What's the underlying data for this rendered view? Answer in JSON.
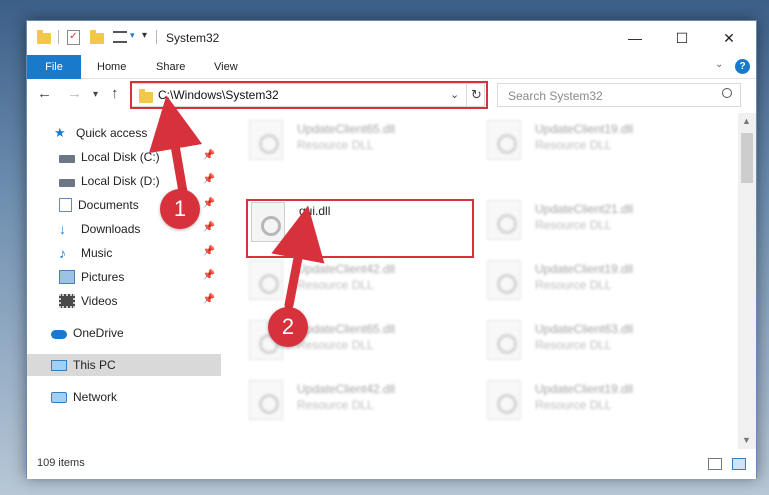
{
  "window": {
    "title": "System32",
    "controls": {
      "minimize": "—",
      "maximize": "☐",
      "close": "✕"
    }
  },
  "ribbon": {
    "file_tab": "File",
    "tabs": [
      "Home",
      "Share",
      "View"
    ],
    "help": "?"
  },
  "navigation": {
    "address": "C:\\Windows\\System32",
    "search_placeholder": "Search System32"
  },
  "sidebar": {
    "items": [
      {
        "label": "Quick access",
        "icon": "star-icon"
      },
      {
        "label": "Local Disk (C:)",
        "icon": "drive-icon",
        "pinned": true
      },
      {
        "label": "Local Disk (D:)",
        "icon": "drive-icon",
        "pinned": true
      },
      {
        "label": "Documents",
        "icon": "documents-icon",
        "pinned": true
      },
      {
        "label": "Downloads",
        "icon": "download-icon",
        "pinned": true
      },
      {
        "label": "Music",
        "icon": "music-icon",
        "pinned": true
      },
      {
        "label": "Pictures",
        "icon": "pictures-icon",
        "pinned": true
      },
      {
        "label": "Videos",
        "icon": "videos-icon",
        "pinned": true
      },
      {
        "label": "OneDrive",
        "icon": "cloud-icon"
      },
      {
        "label": "This PC",
        "icon": "computer-icon",
        "selected": true
      },
      {
        "label": "Network",
        "icon": "network-icon"
      }
    ]
  },
  "files": [
    {
      "name": "UpdateClient65.dll",
      "type": "Resource DLL"
    },
    {
      "name": "UpdateClient19.dll",
      "type": "Resource DLL"
    },
    {
      "name": "gui.dll",
      "type": ""
    },
    {
      "name": "UpdateClient21.dll",
      "type": "Resource DLL"
    },
    {
      "name": "UpdateClient42.dll",
      "type": "Resource DLL"
    },
    {
      "name": "UpdateClient19.dll",
      "type": "Resource DLL"
    },
    {
      "name": "UpdateClient65.dll",
      "type": "Resource DLL"
    },
    {
      "name": "UpdateClient63.dll",
      "type": "Resource DLL"
    },
    {
      "name": "UpdateClient42.dll",
      "type": "Resource DLL"
    },
    {
      "name": "UpdateClient19.dll",
      "type": "Resource DLL"
    }
  ],
  "status": {
    "item_count": "109 items"
  },
  "annotations": {
    "step1": "1",
    "step2": "2"
  },
  "colors": {
    "accent": "#1979ca",
    "highlight": "#d7313b",
    "folder": "#f3c748"
  }
}
